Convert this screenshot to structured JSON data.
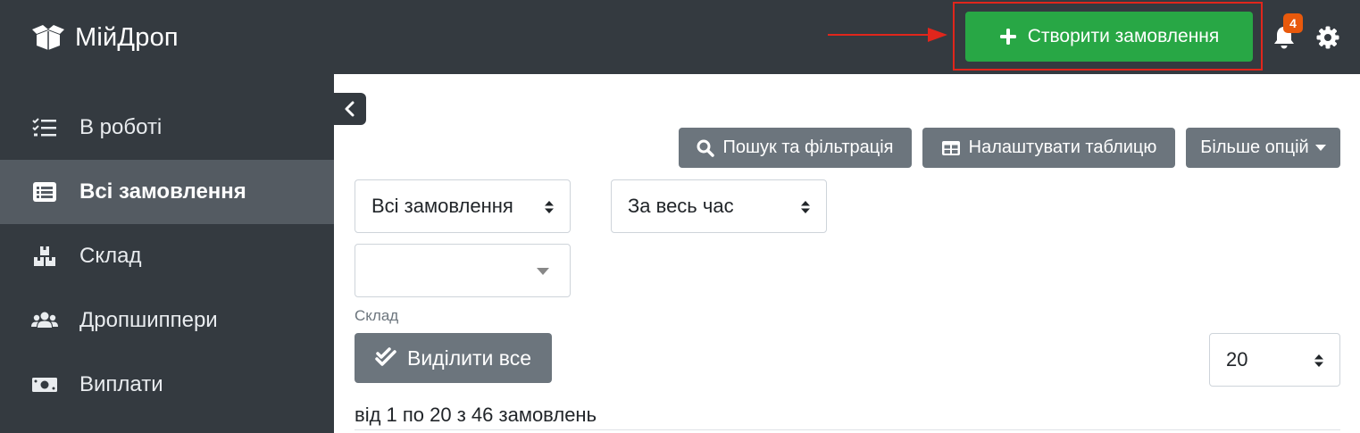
{
  "app": {
    "name": "МійДроп"
  },
  "header": {
    "create_order_label": "Створити замовлення",
    "notifications_count": "4",
    "accent_color": "#28a745",
    "highlight_color": "#e0261c"
  },
  "sidebar": {
    "items": [
      {
        "label": "В роботі",
        "icon": "tasks-icon",
        "active": false
      },
      {
        "label": "Всі замовлення",
        "icon": "list-alt-icon",
        "active": true
      },
      {
        "label": "Склад",
        "icon": "boxes-icon",
        "active": false
      },
      {
        "label": "Дропшиппери",
        "icon": "users-icon",
        "active": false
      },
      {
        "label": "Виплати",
        "icon": "money-bill-icon",
        "active": false
      }
    ]
  },
  "toolbar": {
    "search_filter_label": "Пошук та фільтрація",
    "configure_table_label": "Налаштувати таблицю",
    "more_options_label": "Більше опцій"
  },
  "filters": {
    "order_type_value": "Всі замовлення",
    "period_value": "За весь час",
    "warehouse_value": "",
    "warehouse_label": "Склад"
  },
  "list": {
    "select_all_label": "Виділити все",
    "page_size_value": "20",
    "pagination_text": "від 1 по 20 з 46 замовлень"
  }
}
